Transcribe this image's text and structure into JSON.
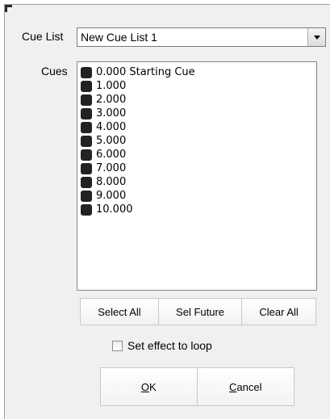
{
  "cue_list": {
    "label": "Cue List",
    "selected_value": "New Cue List 1"
  },
  "cues": {
    "label": "Cues",
    "items": [
      {
        "text": "0.000 Starting Cue"
      },
      {
        "text": "1.000"
      },
      {
        "text": "2.000"
      },
      {
        "text": "3.000"
      },
      {
        "text": "4.000"
      },
      {
        "text": "5.000"
      },
      {
        "text": "6.000"
      },
      {
        "text": "7.000"
      },
      {
        "text": "8.000"
      },
      {
        "text": "9.000"
      },
      {
        "text": "10.000"
      }
    ]
  },
  "selection_buttons": {
    "select_all": "Select All",
    "sel_future": "Sel Future",
    "clear_all": "Clear All"
  },
  "loop": {
    "label": "Set effect to loop",
    "checked": false
  },
  "dialog_buttons": {
    "ok_accel": "O",
    "ok_rest": "K",
    "cancel_accel": "C",
    "cancel_rest": "ancel"
  }
}
